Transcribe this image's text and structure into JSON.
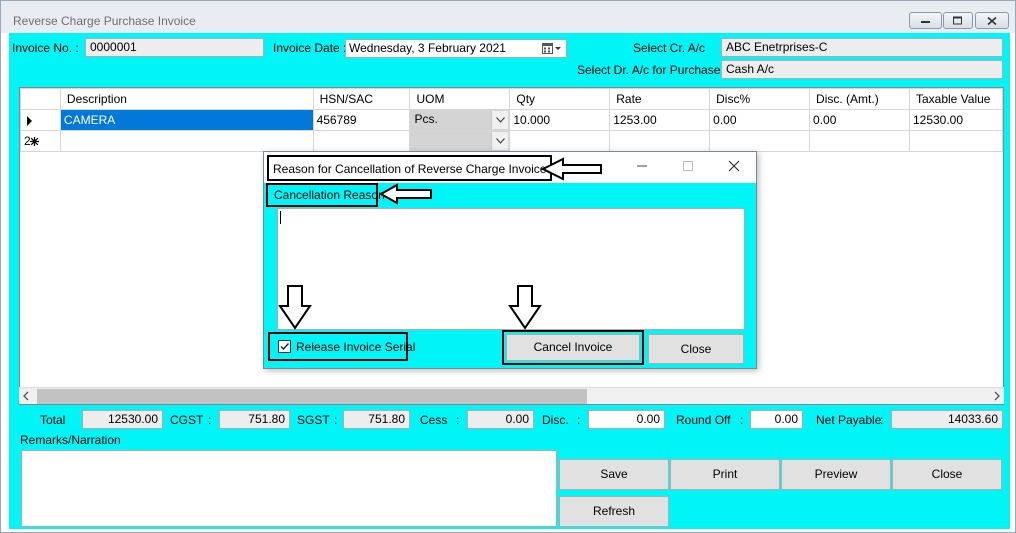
{
  "window": {
    "title": "Reverse Charge Purchase Invoice"
  },
  "header": {
    "invoice_no_label": "Invoice No. :",
    "invoice_no_value": "0000001",
    "invoice_date_label": "Invoice Date :",
    "invoice_date_value": "Wednesday,   3  February  2021",
    "select_cr_label": "Select Cr. A/c",
    "select_cr_value": "ABC Enetrprises-C",
    "select_dr_label": "Select Dr. A/c for Purchase",
    "select_dr_value": "Cash A/c"
  },
  "grid": {
    "columns": [
      "Description",
      "HSN/SAC",
      "UOM",
      "Qty",
      "Rate",
      "Disc%",
      "Disc. (Amt.)",
      "Taxable Value"
    ],
    "rows": [
      {
        "description": "CAMERA",
        "hsn": "456789",
        "uom": "Pcs.",
        "qty": "10.000",
        "rate": "1253.00",
        "disc_pct": "0.00",
        "disc_amt": "0.00",
        "taxable": "12530.00"
      }
    ],
    "new_row_marker": "2"
  },
  "totals": {
    "total_label": "Total",
    "total_value": "12530.00",
    "cgst_label": "CGST",
    "cgst_value": "751.80",
    "sgst_label": "SGST",
    "sgst_value": "751.80",
    "cess_label": "Cess",
    "cess_value": "0.00",
    "disc_label": "Disc.",
    "disc_value": "0.00",
    "roundoff_label": "Round Off",
    "roundoff_value": "0.00",
    "netpay_label": "Net Payable",
    "netpay_value": "14033.60",
    "colon": ":"
  },
  "remarks": {
    "label": "Remarks/Narration"
  },
  "buttons": {
    "save": "Save",
    "print": "Print",
    "preview": "Preview",
    "close": "Close",
    "refresh": "Refresh"
  },
  "dialog": {
    "title": "Reason for Cancellation of Reverse Charge Invoice",
    "reason_label": "Cancellation Reason",
    "release_serial_label": "Release Invoice Serial",
    "release_serial_checked": true,
    "cancel_button": "Cancel Invoice",
    "close_button": "Close"
  },
  "colors": {
    "client_bg": "#00f6f6",
    "selection": "#0078d7"
  }
}
